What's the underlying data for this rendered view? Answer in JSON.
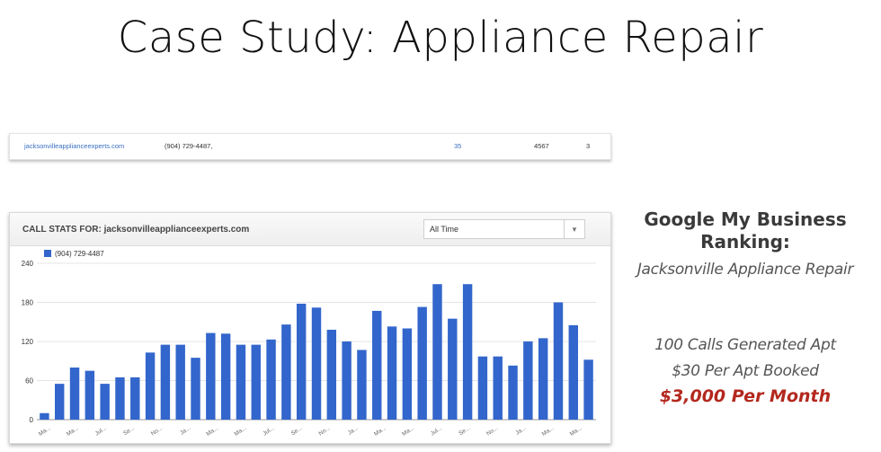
{
  "slide": {
    "title": "Case Study: Appliance Repair"
  },
  "listing_row": {
    "site": "jacksonvilleapplianceexperts.com",
    "phone": "(904) 729-4487,",
    "calls": "35",
    "number": "4567",
    "rank": "3"
  },
  "panel": {
    "title_prefix": "CALL STATS FOR:",
    "title_site": "jacksonvilleapplianceexperts.com",
    "range_select": "All Time",
    "legend_label": "(904) 729-4487"
  },
  "side": {
    "heading_line1": "Google My Business",
    "heading_line2": "Ranking:",
    "subheading": "Jacksonville Appliance Repair",
    "stat_line1": "100 Calls Generated Apt",
    "stat_line2": "$30 Per Apt Booked",
    "stat_line3": "$3,000 Per Month"
  },
  "colors": {
    "bar": "#3366cc",
    "money": "#b3281e",
    "link": "#3a6fc4"
  },
  "chart_data": {
    "type": "bar",
    "series": [
      {
        "name": "(904) 729-4487",
        "values": [
          10,
          55,
          80,
          75,
          55,
          65,
          65,
          103,
          115,
          115,
          95,
          133,
          132,
          115,
          115,
          123,
          146,
          178,
          172,
          138,
          120,
          107,
          167,
          143,
          140,
          173,
          208,
          155,
          208,
          97,
          97,
          83,
          120,
          125,
          180,
          145,
          92
        ]
      }
    ],
    "ylim": [
      0,
      240
    ],
    "yticks": [
      0,
      60,
      120,
      180,
      240
    ],
    "ytick_labels": [
      "0",
      "60",
      "120",
      "180",
      "240"
    ],
    "xtick_labels": [
      "Ma...",
      "Ma...",
      "Jul...",
      "Se...",
      "No...",
      "Ja...",
      "Ma...",
      "Ma...",
      "Jul...",
      "Se...",
      "No...",
      "Ja...",
      "Ma...",
      "Ma...",
      "Jul...",
      "Se...",
      "No...",
      "Ja...",
      "Ma...",
      "Ma..."
    ],
    "grid": true,
    "legend": "top-left"
  }
}
